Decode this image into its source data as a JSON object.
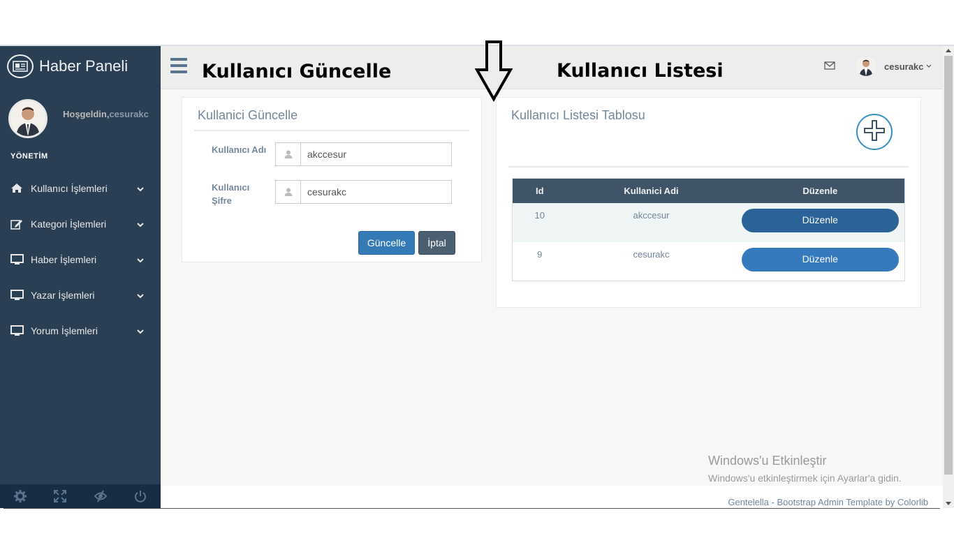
{
  "brand": {
    "title": "Haber Paneli"
  },
  "profile": {
    "greeting": "Hoşgeldin,",
    "username": "cesurakc"
  },
  "sidebar": {
    "section_title": "YÖNETİM",
    "items": [
      {
        "label": "Kullanıcı İşlemleri",
        "icon": "home-icon"
      },
      {
        "label": "Kategori İşlemleri",
        "icon": "edit-icon"
      },
      {
        "label": "Haber İşlemleri",
        "icon": "desktop-icon"
      },
      {
        "label": "Yazar İşlemleri",
        "icon": "desktop-icon"
      },
      {
        "label": "Yorum İşlemleri",
        "icon": "desktop-icon"
      }
    ],
    "footer_icons": [
      "settings-icon",
      "fullscreen-icon",
      "eye-slash-icon",
      "power-icon"
    ]
  },
  "topnav": {
    "username": "cesurakc",
    "mail_icon": "envelope-icon"
  },
  "annotations": {
    "left": "Kullanıcı Güncelle",
    "right": "Kullanıcı Listesi"
  },
  "update_form": {
    "title": "Kullanici Güncelle",
    "username_label": "Kullanıcı Adı",
    "username_value": "akccesur",
    "password_label": "Kullanıcı Şifre",
    "password_value": "cesurakc",
    "update_button": "Güncelle",
    "cancel_button": "İptal"
  },
  "user_list": {
    "title": "Kullanıcı Listesi Tablosu",
    "columns": [
      "Id",
      "Kullanici Adi",
      "Düzenle"
    ],
    "rows": [
      {
        "id": "10",
        "name": "akccesur",
        "action": "Düzenle"
      },
      {
        "id": "9",
        "name": "cesurakc",
        "action": "Düzenle"
      }
    ]
  },
  "watermark": {
    "line1": "Windows'u Etkinleştir",
    "line2": "Windows'u etkinleştirmek için Ayarlar'a gidin."
  },
  "footer": {
    "text": "Gentelella - Bootstrap Admin Template by Colorlib"
  },
  "colors": {
    "sidebar": "#2a3f54",
    "primary": "#337ab7",
    "table_header": "#405467"
  }
}
